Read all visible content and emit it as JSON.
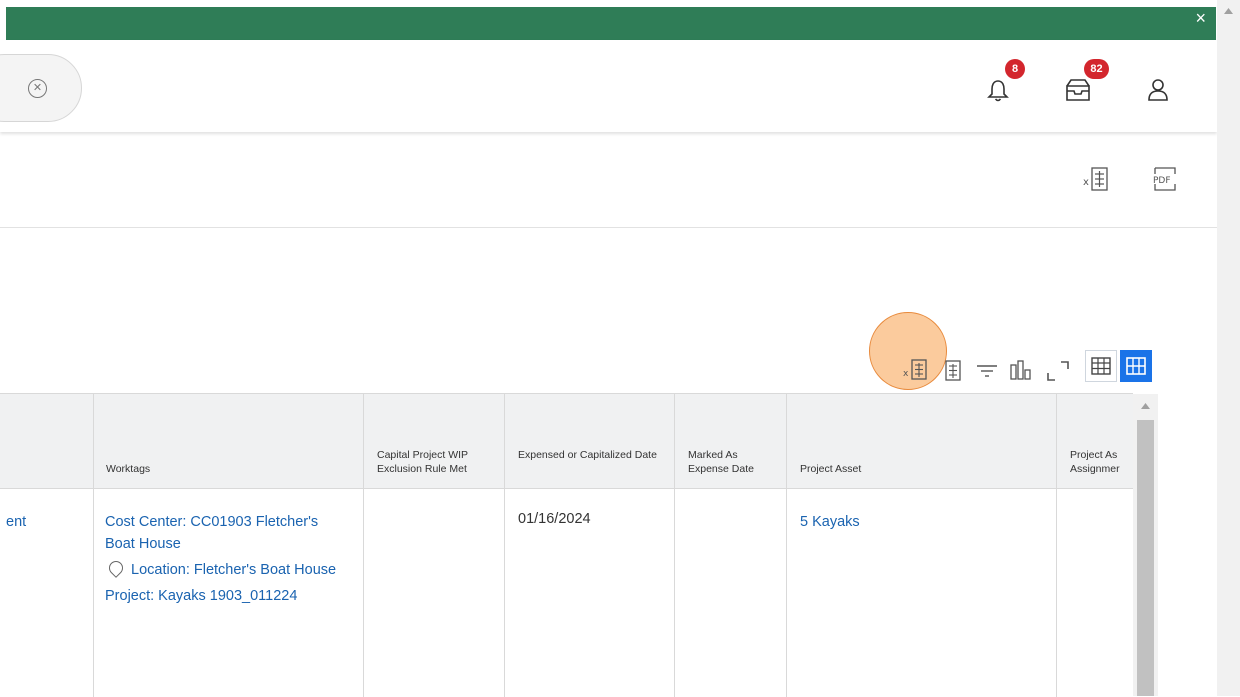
{
  "topbar": {
    "close_label": "×"
  },
  "header": {
    "notifications": {
      "count": "8"
    },
    "inbox": {
      "count": "82"
    }
  },
  "toolbar": {
    "export_excel_icon": "excel-icon",
    "export_pdf_label": "PDF"
  },
  "grid": {
    "columns": [
      {
        "label": ""
      },
      {
        "label": "Worktags"
      },
      {
        "label": "Capital Project WIP Exclusion Rule Met"
      },
      {
        "label": "Expensed or Capitalized Date"
      },
      {
        "label": "Marked As Expense Date"
      },
      {
        "label": "Project Asset"
      },
      {
        "label": "Project As Assignmer"
      }
    ],
    "row": {
      "col0": "ent",
      "worktags": {
        "cost_center": "Cost Center: CC01903 Fletcher's Boat House",
        "location": "Location: Fletcher's Boat House",
        "project": "Project: Kayaks 1903_011224"
      },
      "capital_wip": "",
      "expensed_date": "01/16/2024",
      "marked_expense": "",
      "project_asset": "5 Kayaks",
      "assignment": ""
    }
  },
  "colors": {
    "topbar": "#2f7d57",
    "link": "#1a63b0",
    "badge": "#d3262d",
    "view_active": "#1a73e8"
  }
}
